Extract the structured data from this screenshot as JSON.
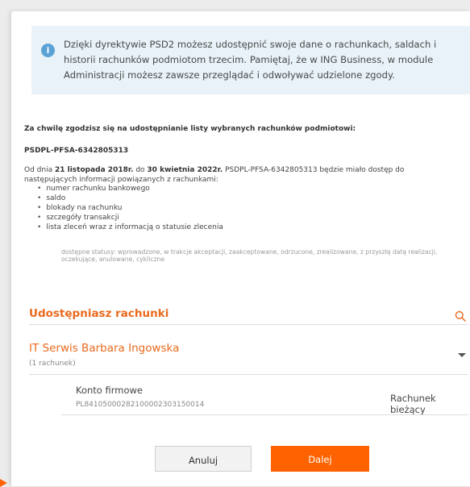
{
  "info": {
    "icon": "info-icon",
    "text": "Dzięki dyrektywie PSD2 możesz udostępnić swoje dane o rachunkach, saldach i historii rachunków podmiotom trzecim. Pamiętaj, że w ING Business, w module Administracji możesz zawsze przeglądać i odwoływać udzielone zgody."
  },
  "consent": {
    "intro": "Za chwilę zgodzisz się na udostępnianie listy wybranych rachunków podmiotowi:",
    "third_party_id": "PSDPL-PFSA-6342805313",
    "desc_prefix": "Od dnia",
    "date_from": "21 listopada 2018r.",
    "desc_mid": "do",
    "date_to": "30 kwietnia 2022r.",
    "desc_suffix": "PSDPL-PFSA-6342805313 będzie miało dostęp do następujących informacji powiązanych z rachunkami:",
    "items": [
      "numer rachunku bankowego",
      "saldo",
      "blokady na rachunku",
      "szczegóły transakcji",
      "lista zleceń wraz z informacją o statusie zlecenia"
    ],
    "statuses": "dostępne statusy: wprowadzone, w trakcje akceptacji, zaakceptowane, odrzucone, zrealizowane, z przyszłą datą realizacji, oczekujące, anulowane, cykliczne"
  },
  "accounts_section": {
    "title": "Udostępniasz rachunki",
    "search_icon": "search-icon",
    "owner": {
      "name": "IT Serwis Barbara Ingowska",
      "count": "(1 rachunek)"
    },
    "accounts": [
      {
        "name": "Konto firmowe",
        "number": "PL84105000282100002303150014",
        "type": "Rachunek bieżący"
      }
    ]
  },
  "actions": {
    "cancel_label": "Anuluj",
    "next_label": "Dalej"
  },
  "colors": {
    "accent": "#ff6200",
    "accent_text": "#ea6a1e",
    "info_bg": "#e8f2f8",
    "info_icon": "#5aa2d6"
  }
}
